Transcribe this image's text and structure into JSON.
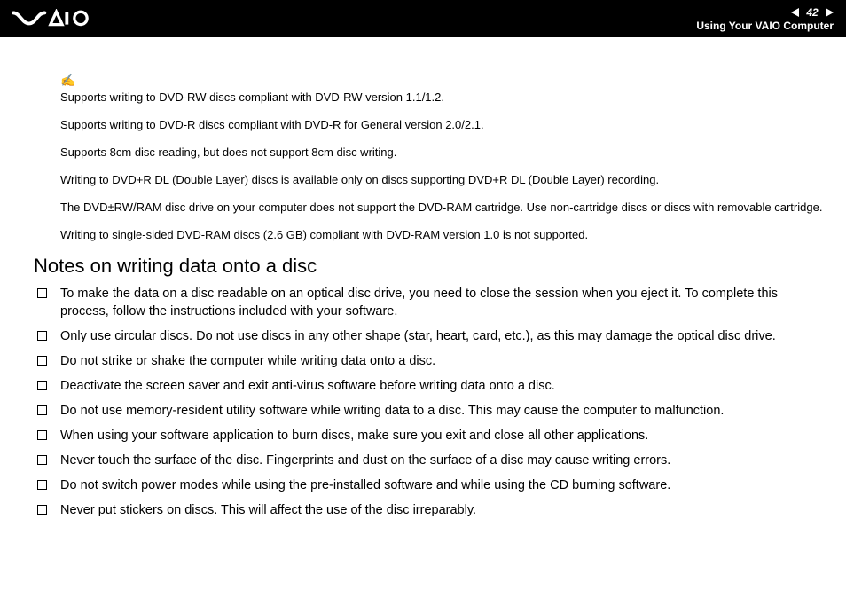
{
  "header": {
    "page_number": "42",
    "section": "Using Your VAIO Computer"
  },
  "notes": [
    "Supports writing to DVD-RW discs compliant with DVD-RW version 1.1/1.2.",
    "Supports writing to DVD-R discs compliant with DVD-R for General version 2.0/2.1.",
    "Supports 8cm disc reading, but does not support 8cm disc writing.",
    "Writing to DVD+R DL (Double Layer) discs is available only on discs supporting DVD+R DL (Double Layer) recording.",
    "The DVD±RW/RAM disc drive on your computer does not support the DVD-RAM cartridge. Use non-cartridge discs or discs with removable cartridge.",
    "Writing to single-sided DVD-RAM discs (2.6 GB) compliant with DVD-RAM version 1.0 is not supported."
  ],
  "heading": "Notes on writing data onto a disc",
  "bullets": [
    "To make the data on a disc readable on an optical disc drive, you need to close the session when you eject it. To complete this process, follow the instructions included with your software.",
    "Only use circular discs. Do not use discs in any other shape (star, heart, card, etc.), as this may damage the optical disc drive.",
    "Do not strike or shake the computer while writing data onto a disc.",
    "Deactivate the screen saver and exit anti-virus software before writing data onto a disc.",
    "Do not use memory-resident utility software while writing data to a disc. This may cause the computer to malfunction.",
    "When using your software application to burn discs, make sure you exit and close all other applications.",
    "Never touch the surface of the disc. Fingerprints and dust on the surface of a disc may cause writing errors.",
    "Do not switch power modes while using the pre-installed software and while using the CD burning software.",
    "Never put stickers on discs. This will affect the use of the disc irreparably."
  ]
}
